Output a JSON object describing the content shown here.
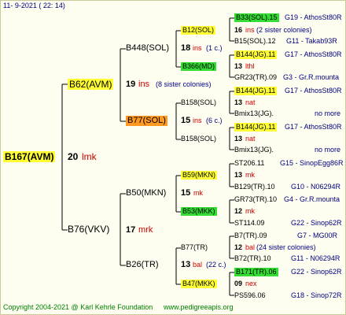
{
  "header": {
    "date": "11-  9-2021 (  22:  14)",
    "color_hex": "#000080"
  },
  "root": {
    "name": "B167(AVM)",
    "value": "20",
    "unit": "lmk"
  },
  "gen1": [
    {
      "name": "B62(AVM)",
      "value": "19",
      "unit": "ins",
      "note": "(8 sister colonies)"
    },
    {
      "name": "B76(VKV)",
      "value": "17",
      "unit": "mrk"
    }
  ],
  "gen2": [
    {
      "name": "B448(SOL)",
      "value": "18",
      "unit": "ins",
      "note": "(1 c.)"
    },
    {
      "name": "B77(SOL)",
      "value": "15",
      "unit": "ins",
      "note": "(6 c.)"
    },
    {
      "name": "B50(MKN)",
      "value": "15",
      "unit": "mk"
    },
    {
      "name": "B26(TR)",
      "value": "13",
      "unit": "bal",
      "note": "(22 c.)"
    }
  ],
  "gen3": [
    {
      "name": "B12(SOL)",
      "value": "16",
      "unit": "ins",
      "note": "(2 sister colonies)"
    },
    {
      "name": "B366(MD)",
      "value": "13",
      "unit": "lthl"
    },
    {
      "name": "B158(SOL)",
      "value": "13",
      "unit": "nat"
    },
    {
      "name": "B158(SOL)",
      "value": "13",
      "unit": "nat"
    },
    {
      "name": "B59(MKN)",
      "value": "13",
      "unit": "mk"
    },
    {
      "name": "B53(MKK)",
      "value": "12",
      "unit": "mk"
    },
    {
      "name": "B77(TR)",
      "value": "12",
      "unit": "bal",
      "note": "(24 sister colonies)"
    },
    {
      "name": "B47(MKK)",
      "value": "09",
      "unit": "nex"
    }
  ],
  "gen4": [
    {
      "name": "B33(SOL).15",
      "extra": "G19 - AthosSt80R"
    },
    {
      "name": "B15(SOL).12",
      "extra": "G11 - Takab93R"
    },
    {
      "name": "B144(JG).11",
      "extra": "G17 - AthosSt80R"
    },
    {
      "name": "GR23(TR).09",
      "extra": "G3 - Gr.R.mounta"
    },
    {
      "name": "B144(JG).11",
      "extra": "G17 - AthosSt80R"
    },
    {
      "name": "Bmix13(JG).",
      "extra": "no more"
    },
    {
      "name": "B144(JG).11",
      "extra": "G17 - AthosSt80R"
    },
    {
      "name": "Bmix13(JG).",
      "extra": "no more"
    },
    {
      "name": "ST206.11",
      "extra": "G15 - SinopEgg86R"
    },
    {
      "name": "B129(TR).10",
      "extra": "G10 - N06294R"
    },
    {
      "name": "GR73(TR).10",
      "extra": "G4 - Gr.R.mounta"
    },
    {
      "name": "ST114.09",
      "extra": "G22 - Sinop62R"
    },
    {
      "name": "B7(TR).09",
      "extra": "G7 - MG00R"
    },
    {
      "name": "B72(TR).10",
      "extra": "G11 - N06294R"
    },
    {
      "name": "B171(TR).06",
      "extra": "G22 - Sinop62R"
    },
    {
      "name": "PS596.06",
      "extra": "G18 - Sinop72R"
    }
  ],
  "footer": {
    "copyright": "Copyright 2004-2021 @ Karl Kehrle Foundation",
    "url": "www.pedigreeapis.org",
    "color_hex": "#008000"
  }
}
